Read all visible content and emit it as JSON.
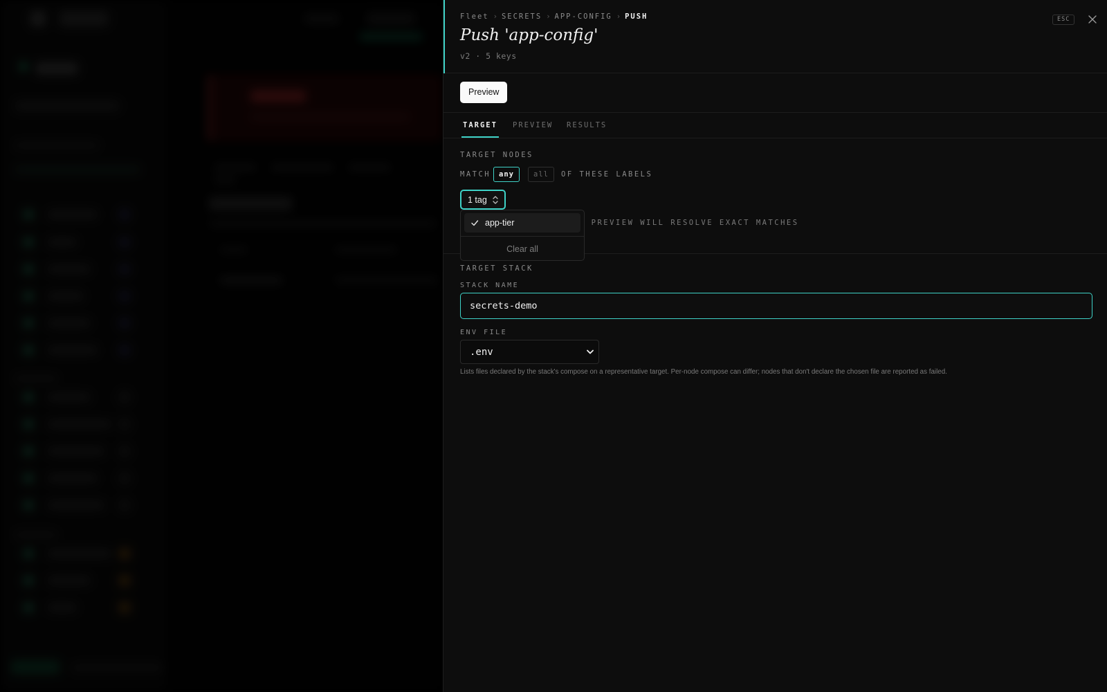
{
  "panel": {
    "breadcrumb": [
      "Fleet",
      "SECRETS",
      "APP-CONFIG",
      "PUSH"
    ],
    "breadcrumb_separator": "›",
    "title": "Push 'app-config'",
    "subtitle": "v2 · 5 keys",
    "esc_label": "ESC",
    "close_icon": "close-icon",
    "preview_button_label": "Preview",
    "tabs": [
      {
        "label": "TARGET",
        "active": true
      },
      {
        "label": "PREVIEW",
        "active": false
      },
      {
        "label": "RESULTS",
        "active": false
      }
    ],
    "target_nodes": {
      "heading": "TARGET NODES",
      "match_label": "MATCH",
      "match_options": [
        "any",
        "all"
      ],
      "match_selected": "any",
      "match_tail": "OF THESE LABELS",
      "tag_select_value": "1 tag",
      "hint_visible": "· PREVIEW WILL RESOLVE EXACT MATCHES",
      "dropdown": {
        "items": [
          {
            "label": "app-tier",
            "checked": true
          }
        ],
        "clear_label": "Clear all"
      }
    },
    "target_stack": {
      "heading": "TARGET STACK",
      "stack_name_label": "STACK NAME",
      "stack_name_value": "secrets-demo",
      "env_file_label": "ENV FILE",
      "env_file_value": ".env",
      "help_text": "Lists files declared by the stack's compose on a representative target. Per-node compose can differ; nodes that don't declare the chosen file are reported as failed."
    }
  },
  "colors": {
    "accent": "#3fd3c8",
    "panel_bg": "#0d0d0d",
    "page_bg": "#000000"
  }
}
